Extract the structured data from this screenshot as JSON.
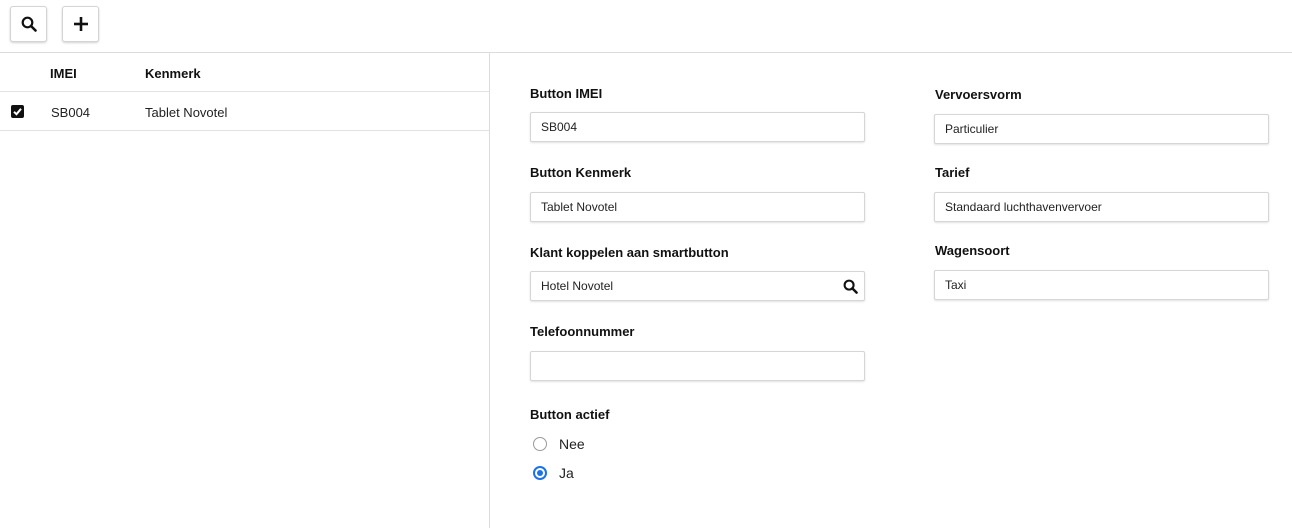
{
  "toolbar": {
    "search_icon": "search-icon",
    "add_icon": "plus-icon"
  },
  "list": {
    "headers": {
      "imei": "IMEI",
      "kenmerk": "Kenmerk"
    },
    "rows": [
      {
        "checked": true,
        "imei": "SB004",
        "kenmerk": "Tablet Novotel"
      }
    ]
  },
  "form": {
    "button_imei": {
      "label": "Button IMEI",
      "value": "SB004"
    },
    "button_kenmerk": {
      "label": "Button Kenmerk",
      "value": "Tablet Novotel"
    },
    "klant": {
      "label": "Klant koppelen aan smartbutton",
      "value": "Hotel Novotel"
    },
    "telefoon": {
      "label": "Telefoonnummer",
      "value": ""
    },
    "button_actief": {
      "label": "Button actief",
      "options": [
        {
          "label": "Nee",
          "selected": false
        },
        {
          "label": "Ja",
          "selected": true
        }
      ]
    },
    "vervoersvorm": {
      "label": "Vervoersvorm",
      "value": "Particulier"
    },
    "tarief": {
      "label": "Tarief",
      "value": "Standaard luchthavenvervoer"
    },
    "wagensoort": {
      "label": "Wagensoort",
      "value": "Taxi"
    }
  },
  "colors": {
    "accent": "#1a73e8",
    "border": "#d6d6d6"
  }
}
